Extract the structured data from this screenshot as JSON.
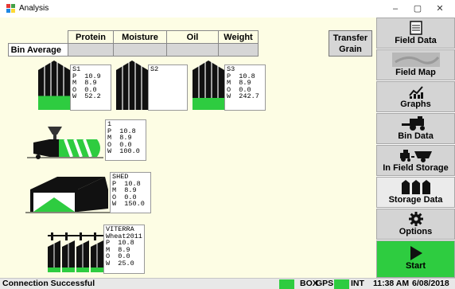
{
  "window": {
    "title": "Analysis",
    "minimize": "–",
    "maximize": "▢",
    "close": "✕"
  },
  "bin_average": {
    "row_label": "Bin Average",
    "columns": [
      "Protein",
      "Moisture",
      "Oil",
      "Weight"
    ],
    "values": [
      "",
      "",
      "",
      ""
    ]
  },
  "transfer_button": {
    "line1": "Transfer",
    "line2": "Grain"
  },
  "storages": [
    {
      "name": "S1",
      "p": "P  10.9",
      "m": "M  8.9",
      "o": "O  0.0",
      "w": "W  52.2",
      "fill_fraction": 0.35
    },
    {
      "name": "S2",
      "p": "",
      "m": "",
      "o": "",
      "w": "",
      "fill_fraction": 0
    },
    {
      "name": "S3",
      "p": "P  10.8",
      "m": "M  8.9",
      "o": "O  0.0",
      "w": "W  242.7",
      "fill_fraction": 0.3
    }
  ],
  "bag": {
    "name": "1",
    "p": "P  10.8",
    "m": "M  8.9",
    "o": "O  0.0",
    "w": "W  100.0"
  },
  "shed": {
    "name": "SHED",
    "p": "P  10.8",
    "m": "M  8.9",
    "o": "O  0.0",
    "w": "W  150.0"
  },
  "elevator": {
    "name": "VITERRA",
    "crop": "Wheat2011",
    "p": "P  10.8",
    "m": "M  8.9",
    "o": "O  0.0",
    "w": "W  25.0"
  },
  "sidebar": {
    "items": [
      {
        "label": "Field Data",
        "icon": "document-icon"
      },
      {
        "label": "Field Map",
        "icon": "map-thumbnail-icon"
      },
      {
        "label": "Graphs",
        "icon": "chart-line-icon"
      },
      {
        "label": "Bin Data",
        "icon": "combine-icon"
      },
      {
        "label": "In Field Storage",
        "icon": "tractor-cart-icon"
      },
      {
        "label": "Storage Data",
        "icon": "grain-bins-icon"
      },
      {
        "label": "Options",
        "icon": "gear-icon"
      },
      {
        "label": "Start",
        "icon": "play-icon"
      }
    ]
  },
  "status": {
    "message": "Connection Successful",
    "box": "BOX",
    "gps": "GPS",
    "int": "INT",
    "time": "11:38 AM",
    "date": "6/08/2018",
    "led_color": "#2ecc40"
  }
}
